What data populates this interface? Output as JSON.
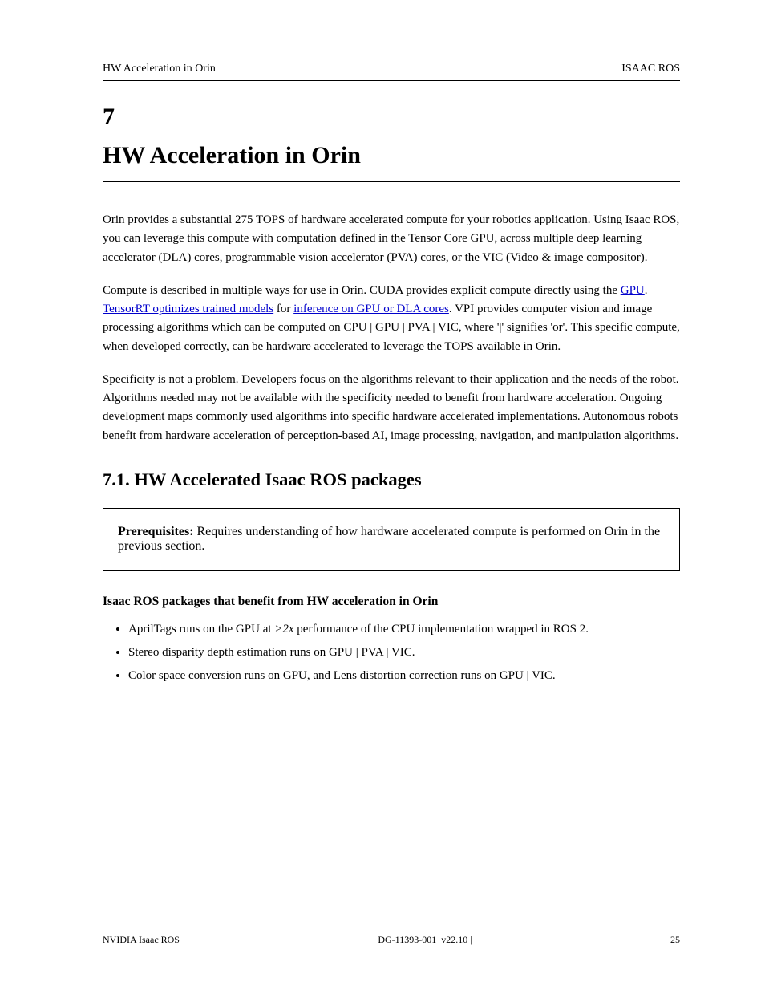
{
  "header": {
    "left": "HW Acceleration in Orin",
    "right": "ISAAC ROS"
  },
  "section": {
    "number": "7",
    "title": "HW Acceleration in Orin"
  },
  "intro_para": "Orin provides a substantial 275 TOPS of hardware accelerated compute for your robotics application. Using Isaac ROS, you can leverage this compute with computation defined in the Tensor Core GPU, across multiple deep learning accelerator (DLA) cores, programmable vision accelerator (PVA) cores, or the VIC (Video & image compositor).",
  "compute_para": {
    "pre_link1": "Compute is described in multiple ways for use in Orin. CUDA provides explicit compute directly using the ",
    "link1_text": "GPU",
    "between1": ". ",
    "link2_text": "TensorRT optimizes trained models",
    "between2": " for ",
    "link3_text": "inference on GPU or DLA cores",
    "after3": ". VPI provides computer vision and image processing algorithms which can be computed on CPU | GPU | PVA | VIC, where '|' signifies 'or'. This specific compute, when developed correctly, can be hardware accelerated to leverage the TOPS available in Orin."
  },
  "specificity_para": "Specificity is not a problem. Developers focus on the algorithms relevant to their application and the needs of the robot. Algorithms needed may not be available with the specificity needed to benefit from hardware acceleration. Ongoing development maps commonly used algorithms into specific hardware accelerated implementations. Autonomous robots benefit from hardware acceleration of perception-based AI, image processing, navigation, and manipulation algorithms.",
  "h2": "7.1. HW Accelerated Isaac ROS packages",
  "prereq": {
    "label": "Prerequisites: ",
    "text": "Requires understanding of how hardware accelerated compute is performed on Orin in the previous section."
  },
  "h3": "Isaac ROS packages that benefit from HW acceleration in Orin",
  "bullets": [
    {
      "pre": "AprilTags runs on the GPU at ",
      "em": ">2x",
      "post": " performance of the CPU implementation wrapped in ROS 2."
    },
    {
      "text": "Stereo disparity depth estimation runs on GPU | PVA | VIC."
    },
    {
      "text": "Color space conversion runs on GPU, and Lens distortion correction runs on GPU | VIC."
    }
  ],
  "footer": {
    "left": "NVIDIA Isaac ROS",
    "center": "DG-11393-001_v22.10   |",
    "right": "25"
  }
}
